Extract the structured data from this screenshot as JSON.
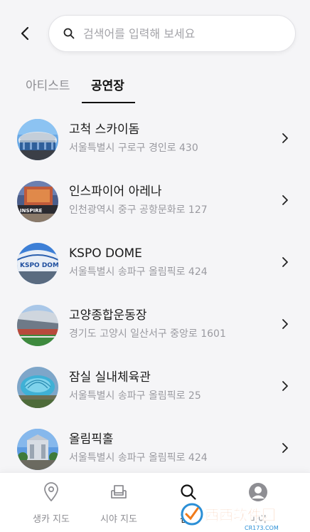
{
  "search": {
    "placeholder": "검색어를 입력해 보세요"
  },
  "tabs": [
    {
      "label": "아티스트",
      "active": false
    },
    {
      "label": "공연장",
      "active": true
    }
  ],
  "venues": [
    {
      "name": "고척 스카이돔",
      "address": "서울특별시 구로구 경인로 430"
    },
    {
      "name": "인스파이어 아레나",
      "address": "인천광역시 중구 공항문화로 127",
      "thumb_text": "INSPIRE"
    },
    {
      "name": "KSPO DOME",
      "address": "서울특별시 송파구 올림픽로 424",
      "thumb_text": "KSPO DOME"
    },
    {
      "name": "고양종합운동장",
      "address": "경기도 고양시 일산서구 중앙로 1601"
    },
    {
      "name": "잠실 실내체육관",
      "address": "서울특별시 송파구 올림픽로 25"
    },
    {
      "name": "올림픽홀",
      "address": "서울특별시 송파구 올림픽로 424"
    }
  ],
  "bottom_nav": [
    {
      "label": "생카 지도",
      "icon": "location-pin-icon"
    },
    {
      "label": "시야 지도",
      "icon": "seat-icon"
    },
    {
      "label": "검색",
      "icon": "search-icon",
      "active": true
    },
    {
      "label": "마이",
      "icon": "profile-icon"
    }
  ],
  "watermark": {
    "text": "西西软件园",
    "subtext": "CR173.COM"
  },
  "colors": {
    "background": "#f5f5f7",
    "text_primary": "#1a1a1a",
    "text_secondary": "#9a9aa0",
    "tab_inactive": "#8e8e93"
  }
}
